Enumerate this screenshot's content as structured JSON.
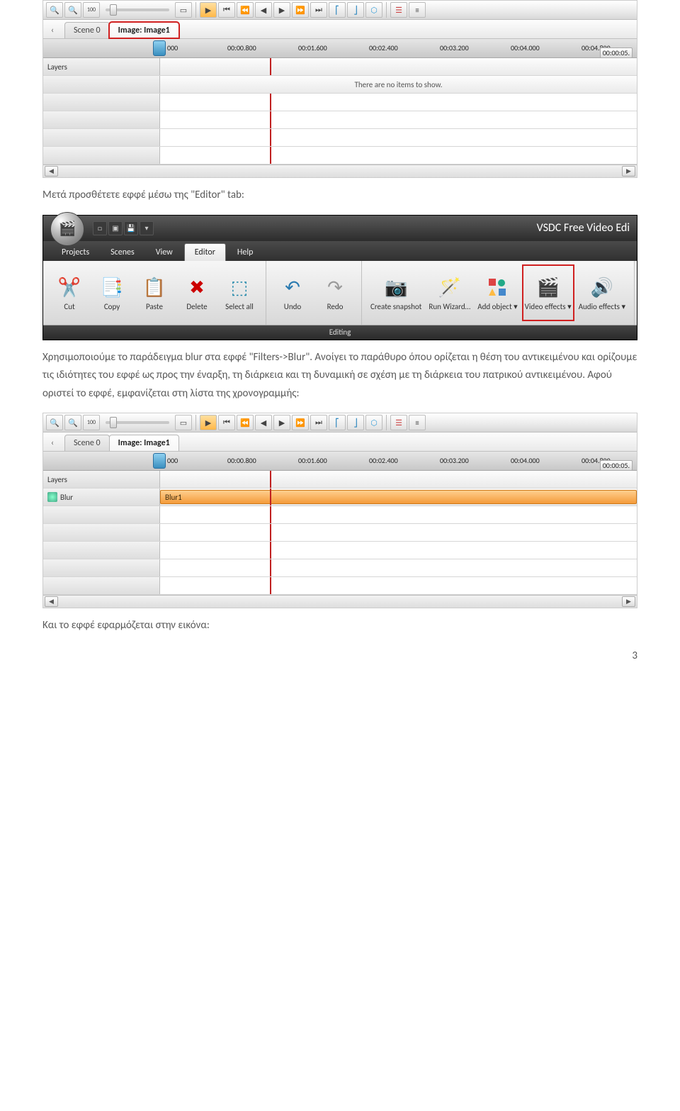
{
  "figure1": {
    "tabs": {
      "scene": "Scene 0",
      "image": "Image: Image1"
    },
    "ruler": {
      "ticks": [
        "000",
        "00:00.800",
        "00:01.600",
        "00:02.400",
        "00:03.200",
        "00:04.000",
        "00:04.800"
      ],
      "end": "00:00:05."
    },
    "layers_label": "Layers",
    "empty_message": "There are no items to show."
  },
  "para1": "Μετά προσθέτετε εφφέ μέσω της \"Editor\" tab:",
  "figure2": {
    "app_title": "VSDC Free Video Edi",
    "tabs": [
      "Projects",
      "Scenes",
      "View",
      "Editor",
      "Help"
    ],
    "buttons": {
      "cut": "Cut",
      "copy": "Copy",
      "paste": "Paste",
      "delete": "Delete",
      "select_all": "Select all",
      "undo": "Undo",
      "redo": "Redo",
      "create_snapshot": "Create snapshot",
      "run_wizard": "Run Wizard…",
      "add_object": "Add object ▾",
      "video_effects": "Video effects ▾",
      "audio_effects": "Audio effects ▾"
    },
    "group_footer": "Editing"
  },
  "para2": "Χρησιμοποιούμε το παράδειγμα blur  στα εφφέ  \"Filters->Blur\". Ανοίγει το παράθυρο όπου ορίζεται η θέση του αντικειμένου και ορίζουμε τις ιδιότητες του εφφέ ως προς την έναρξη, τη διάρκεια και τη δυναμική σε σχέση με τη διάρκεια του πατρικού αντικειμένου. Αφού οριστεί το εφφέ, εμφανίζεται στη λίστα της χρονογραμμής:",
  "figure3": {
    "tabs": {
      "scene": "Scene 0",
      "image": "Image: Image1"
    },
    "ruler": {
      "ticks": [
        "000",
        "00:00.800",
        "00:01.600",
        "00:02.400",
        "00:03.200",
        "00:04.000",
        "00:04.800"
      ],
      "end": "00:00:05."
    },
    "layers_label": "Layers",
    "blur_layer": "Blur",
    "blur_clip": "Blur1"
  },
  "para3": "Και το εφφέ εφαρμόζεται στην εικόνα:",
  "page_num": "3"
}
